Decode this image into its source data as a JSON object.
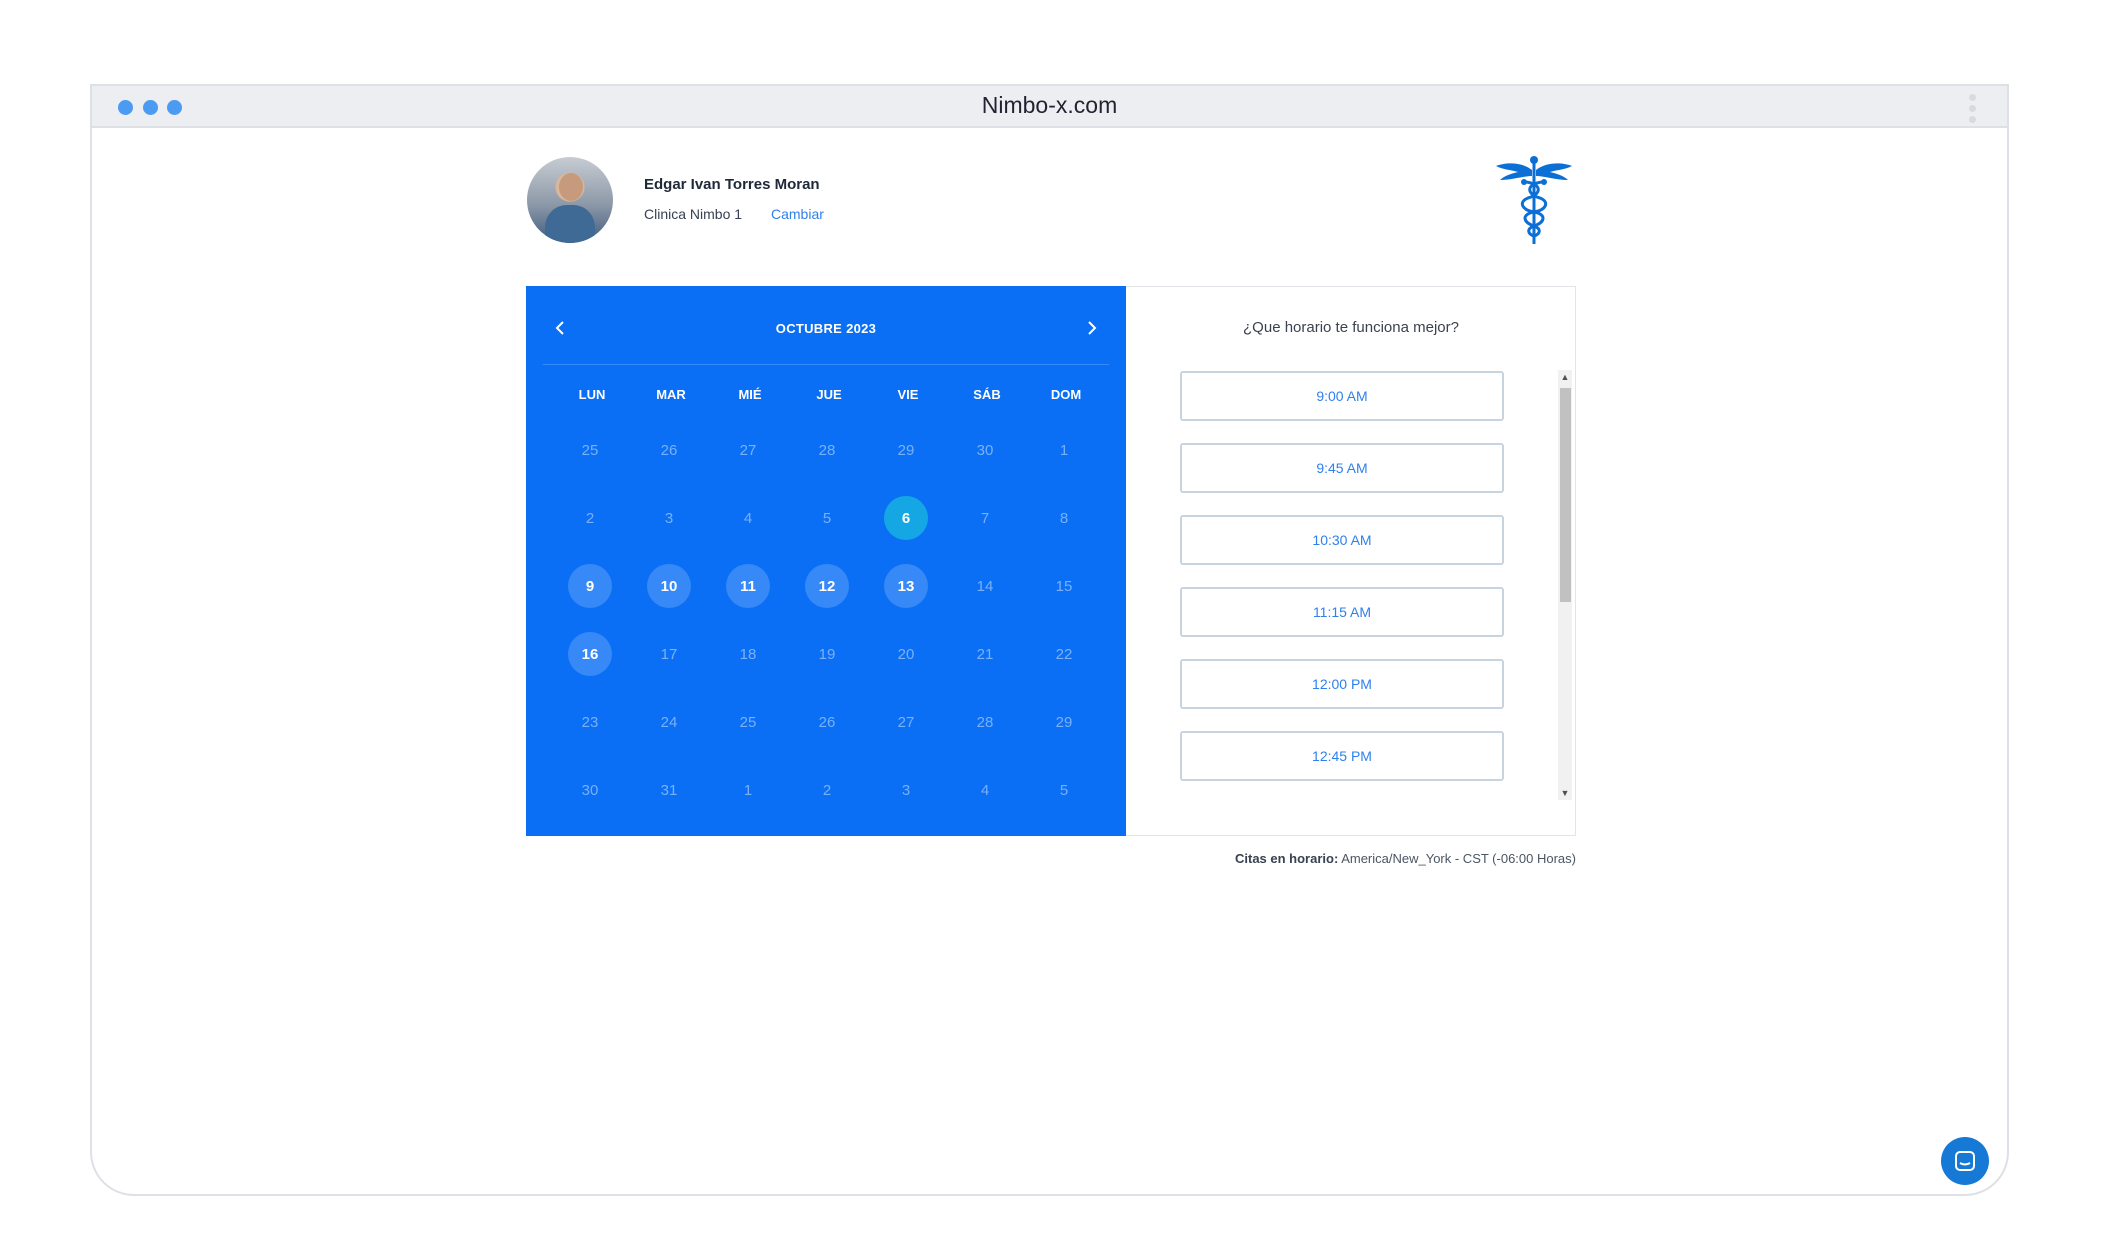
{
  "browser": {
    "url": "Nimbo-x.com"
  },
  "doctor": {
    "name": "Edgar Ivan Torres Moran",
    "clinic": "Clinica Nimbo 1",
    "change_label": "Cambiar"
  },
  "calendar": {
    "month_label": "OCTUBRE 2023",
    "weekdays": [
      "LUN",
      "MAR",
      "MIÉ",
      "JUE",
      "VIE",
      "SÁB",
      "DOM"
    ],
    "weeks": [
      [
        {
          "d": "25",
          "s": "muted"
        },
        {
          "d": "26",
          "s": "muted"
        },
        {
          "d": "27",
          "s": "muted"
        },
        {
          "d": "28",
          "s": "muted"
        },
        {
          "d": "29",
          "s": "muted"
        },
        {
          "d": "30",
          "s": "muted"
        },
        {
          "d": "1",
          "s": "muted"
        }
      ],
      [
        {
          "d": "2",
          "s": "muted"
        },
        {
          "d": "3",
          "s": "muted"
        },
        {
          "d": "4",
          "s": "muted"
        },
        {
          "d": "5",
          "s": "muted"
        },
        {
          "d": "6",
          "s": "selected"
        },
        {
          "d": "7",
          "s": "muted"
        },
        {
          "d": "8",
          "s": "muted"
        }
      ],
      [
        {
          "d": "9",
          "s": "available"
        },
        {
          "d": "10",
          "s": "available"
        },
        {
          "d": "11",
          "s": "available"
        },
        {
          "d": "12",
          "s": "available"
        },
        {
          "d": "13",
          "s": "available"
        },
        {
          "d": "14",
          "s": "muted"
        },
        {
          "d": "15",
          "s": "muted"
        }
      ],
      [
        {
          "d": "16",
          "s": "available"
        },
        {
          "d": "17",
          "s": "muted"
        },
        {
          "d": "18",
          "s": "muted"
        },
        {
          "d": "19",
          "s": "muted"
        },
        {
          "d": "20",
          "s": "muted"
        },
        {
          "d": "21",
          "s": "muted"
        },
        {
          "d": "22",
          "s": "muted"
        }
      ],
      [
        {
          "d": "23",
          "s": "muted"
        },
        {
          "d": "24",
          "s": "muted"
        },
        {
          "d": "25",
          "s": "muted"
        },
        {
          "d": "26",
          "s": "muted"
        },
        {
          "d": "27",
          "s": "muted"
        },
        {
          "d": "28",
          "s": "muted"
        },
        {
          "d": "29",
          "s": "muted"
        }
      ],
      [
        {
          "d": "30",
          "s": "muted"
        },
        {
          "d": "31",
          "s": "muted"
        },
        {
          "d": "1",
          "s": "muted"
        },
        {
          "d": "2",
          "s": "muted"
        },
        {
          "d": "3",
          "s": "muted"
        },
        {
          "d": "4",
          "s": "muted"
        },
        {
          "d": "5",
          "s": "muted"
        }
      ]
    ]
  },
  "slots": {
    "title": "¿Que horario te funciona mejor?",
    "times": [
      "9:00 AM",
      "9:45 AM",
      "10:30 AM",
      "11:15 AM",
      "12:00 PM",
      "12:45 PM"
    ]
  },
  "timezone": {
    "label": "Citas en horario:",
    "value": "America/New_York - CST (-06:00 Horas)"
  },
  "colors": {
    "calendar_bg": "#0a6ff5",
    "selected_day": "#15a7e3",
    "link": "#2f80ed",
    "caduceus": "#0b6fd6"
  },
  "icons": {
    "logo": "caduceus-icon",
    "chat": "chat-icon",
    "prev": "chevron-left-icon",
    "next": "chevron-right-icon"
  }
}
